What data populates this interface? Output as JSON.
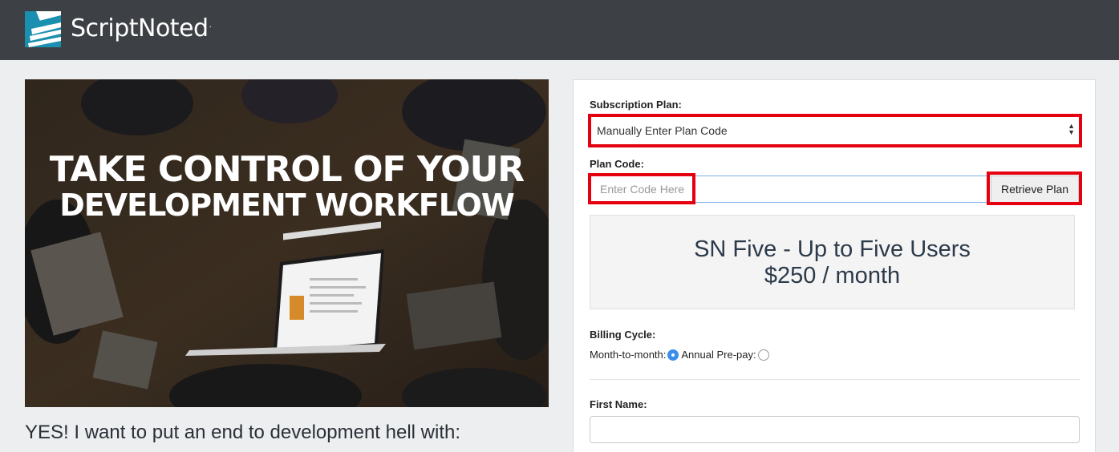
{
  "brand": {
    "name": "ScriptNoted",
    "trademark": "."
  },
  "hero": {
    "title_line1": "TAKE CONTROL OF YOUR",
    "title_line2": "DEVELOPMENT WORKFLOW"
  },
  "tagline": "YES! I want to put an end to development hell with:",
  "form": {
    "subscription_label": "Subscription Plan:",
    "subscription_selected": "Manually Enter Plan Code",
    "plan_code_label": "Plan Code:",
    "plan_code_placeholder": "Enter Code Here",
    "retrieve_button": "Retrieve Plan",
    "plan_name": "SN Five - Up to Five Users",
    "plan_price": "$250 / month",
    "billing_label": "Billing Cycle:",
    "billing_options": [
      {
        "label": "Month-to-month:",
        "selected": true
      },
      {
        "label": "Annual Pre-pay:",
        "selected": false
      }
    ],
    "first_name_label": "First Name:"
  },
  "colors": {
    "topbar": "#3d4044",
    "logo_accent": "#1a8fb0",
    "highlight": "#e4000f",
    "radio_selected": "#3b8eea"
  }
}
